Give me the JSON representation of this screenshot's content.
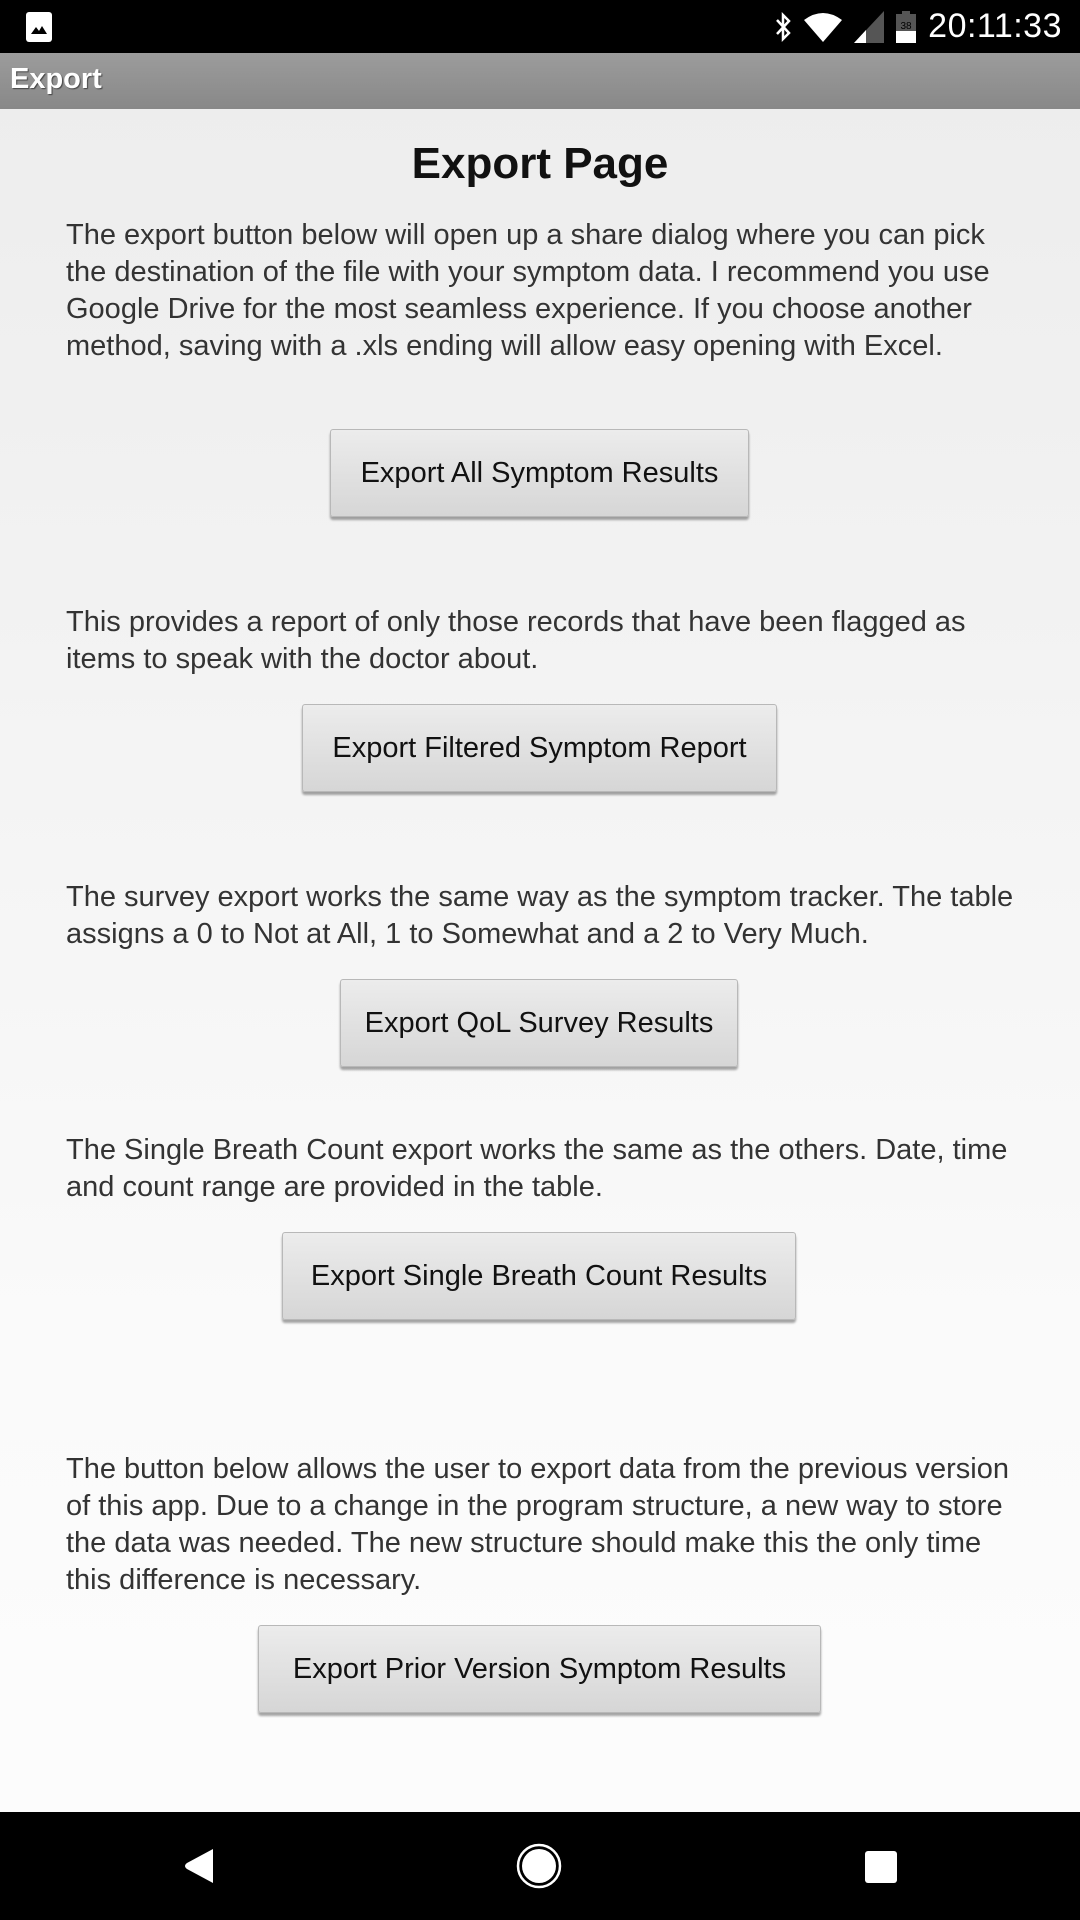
{
  "status_bar": {
    "time": "20:11:33",
    "battery_level": "38",
    "icons": [
      "gallery-notification-icon",
      "bluetooth-icon",
      "wifi-icon",
      "cell-signal-icon",
      "battery-icon"
    ]
  },
  "app_bar": {
    "title": "Export"
  },
  "page": {
    "title": "Export Page",
    "sections": [
      {
        "description": "The export button below will open up a share dialog where you can pick the destination of the file with your symptom data. I recommend you use Google Drive for the most seamless experience. If you choose another method, saving with a .xls ending will allow easy opening with Excel.",
        "button_label": "Export All Symptom Results"
      },
      {
        "description": "This provides a report of only those records that have been flagged as items to speak with the doctor about.",
        "button_label": "Export Filtered Symptom Report"
      },
      {
        "description": "The survey export works the same way as the symptom tracker. The table assigns a 0 to Not at All, 1 to Somewhat and a 2 to Very Much.",
        "button_label": "Export QoL Survey Results"
      },
      {
        "description": "The Single Breath Count export works the same as the others. Date, time and count range are provided in the table.",
        "button_label": "Export Single Breath Count Results"
      },
      {
        "description": "The button below allows the user to export data from the previous version of this app. Due to a change in the program structure, a new way to store the data was needed. The new structure should make this the only time this difference is necessary.",
        "button_label": "Export Prior Version Symptom Results"
      }
    ]
  },
  "nav_bar": {
    "buttons": [
      "back",
      "home",
      "recents"
    ]
  }
}
